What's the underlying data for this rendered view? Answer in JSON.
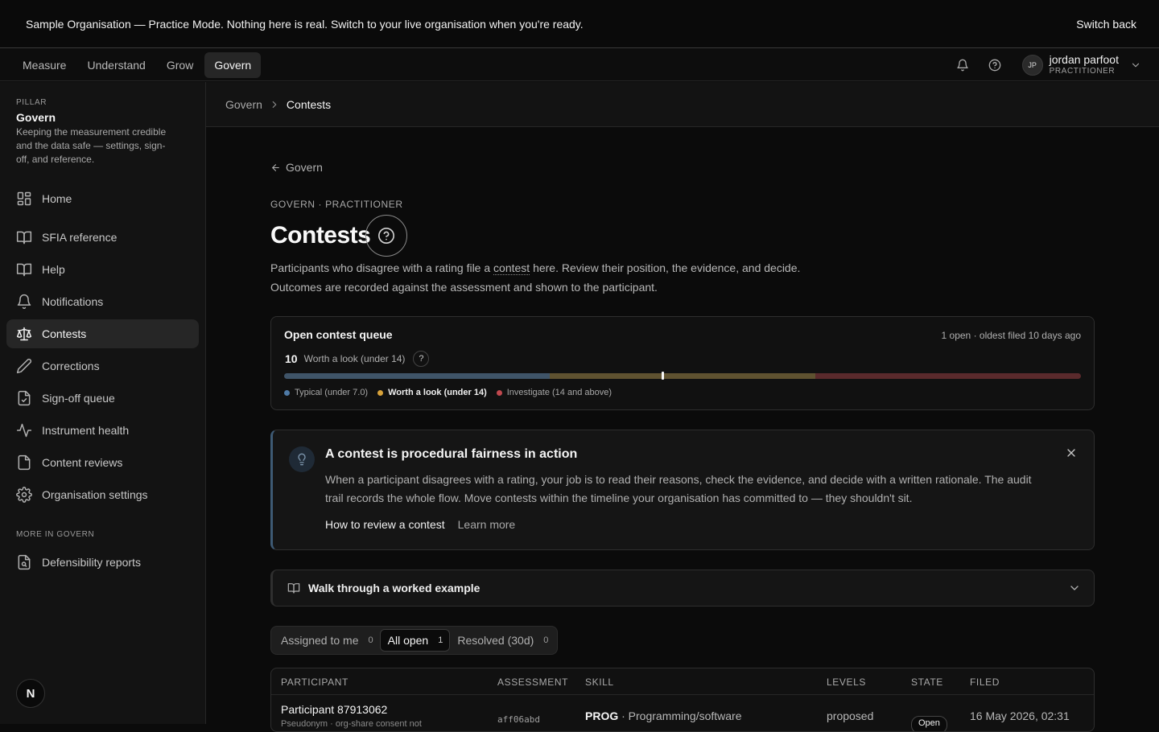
{
  "banner": {
    "org_mode": "Sample Organisation — Practice Mode.",
    "message": " Nothing here is real. Switch to your live organisation when you're ready.",
    "switch_back": "Switch back"
  },
  "topnav": {
    "tabs": [
      {
        "label": "Measure",
        "active": false
      },
      {
        "label": "Understand",
        "active": false
      },
      {
        "label": "Grow",
        "active": false
      },
      {
        "label": "Govern",
        "active": true
      }
    ],
    "user": {
      "initials": "JP",
      "name": "jordan parfoot",
      "role": "PRACTITIONER"
    }
  },
  "sidebar": {
    "kicker": "PILLAR",
    "title": "Govern",
    "description": "Keeping the measurement credible and the data safe — settings, sign-off, and reference.",
    "items": [
      {
        "label": "Home",
        "icon": "home-grid-icon",
        "active": false
      },
      {
        "label": "SFIA reference",
        "icon": "book-icon",
        "active": false
      },
      {
        "label": "Help",
        "icon": "book-icon",
        "active": false
      },
      {
        "label": "Notifications",
        "icon": "bell-icon",
        "active": false
      },
      {
        "label": "Contests",
        "icon": "scales-icon",
        "active": true
      },
      {
        "label": "Corrections",
        "icon": "pencil-icon",
        "active": false
      },
      {
        "label": "Sign-off queue",
        "icon": "file-check-icon",
        "active": false
      },
      {
        "label": "Instrument health",
        "icon": "activity-icon",
        "active": false
      },
      {
        "label": "Content reviews",
        "icon": "file-icon",
        "active": false
      },
      {
        "label": "Organisation settings",
        "icon": "gear-icon",
        "active": false
      }
    ],
    "more_title": "MORE IN GOVERN",
    "more_items": [
      {
        "label": "Defensibility reports",
        "icon": "file-search-icon"
      }
    ],
    "logo_letter": "N"
  },
  "breadcrumb": {
    "parent": "Govern",
    "current": "Contests"
  },
  "page": {
    "back_label": "Govern",
    "kicker": "GOVERN · PRACTITIONER",
    "title": "Contests",
    "lead_1": "Participants who disagree with a rating file a ",
    "lead_term": "contest",
    "lead_2": " here. Review their position, the evidence, and decide. Outcomes are recorded against the assessment and shown to the participant."
  },
  "queue": {
    "title": "Open contest queue",
    "meta": "1 open · oldest filed 10 days ago",
    "score": "10",
    "score_label": "Worth a look (under 14)",
    "help": "?",
    "marker_fraction": 0.475,
    "bands": [
      {
        "label": "Typical (under 7.0)",
        "color": "#3f5468",
        "share": 0.3333
      },
      {
        "label": "Worth a look (under 14)",
        "color": "#5f5230",
        "share": 0.3333
      },
      {
        "label": "Investigate (14 and above)",
        "color": "#5a2a2c",
        "share": 0.3334
      }
    ],
    "legend_dots": [
      "#4e7aa6",
      "#d8a23a",
      "#c0484e"
    ]
  },
  "callout": {
    "title": "A contest is procedural fairness in action",
    "body": "When a participant disagrees with a rating, your job is to read their reasons, check the evidence, and decide with a written rationale. The audit trail records the whole flow. Move contests within the timeline your organisation has committed to — they shouldn't sit.",
    "link_primary": "How to review a contest",
    "link_secondary": "Learn more"
  },
  "walkthrough": {
    "label": "Walk through a worked example"
  },
  "filters": [
    {
      "label": "Assigned to me",
      "count": "0",
      "active": false
    },
    {
      "label": "All open",
      "count": "1",
      "active": true
    },
    {
      "label": "Resolved (30d)",
      "count": "0",
      "active": false
    }
  ],
  "table": {
    "columns": [
      "PARTICIPANT",
      "ASSESSMENT",
      "SKILL",
      "LEVELS",
      "STATE",
      "FILED"
    ],
    "rows": [
      {
        "participant": "Participant 87913062",
        "participant_sub": "Pseudonym · org-share consent not",
        "assessment": "aff06abd",
        "skill_code": "PROG",
        "skill_name": " · Programming/software",
        "levels": "proposed",
        "state": "Open",
        "filed": "16 May 2026, 02:31"
      }
    ]
  },
  "colors": {
    "accent_callout": "#3e5a74",
    "background": "#0b0b0b"
  }
}
